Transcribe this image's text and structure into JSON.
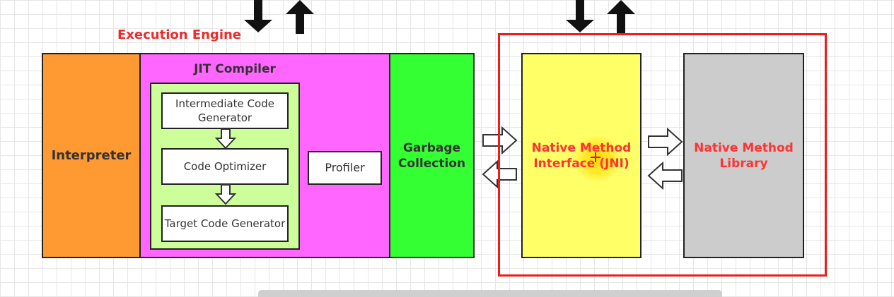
{
  "title": "Execution Engine",
  "interpreter": "Interpreter",
  "jit": {
    "title": "JIT Compiler",
    "intermediate": "Intermediate Code Generator",
    "optimizer": "Code Optimizer",
    "target": "Target Code Generator",
    "profiler": "Profiler"
  },
  "gc": "Garbage Collection",
  "jni": "Native Method Interface (JNI)",
  "library": "Native Method Library",
  "colors": {
    "interpreter": "#ff9a33",
    "jit": "#ff66ff",
    "jit_inner": "#ccff99",
    "gc": "#33ff33",
    "jni": "#ffff66",
    "library": "#cccccc",
    "highlight": "#ee1c1c",
    "label_red": "#ff3333"
  }
}
